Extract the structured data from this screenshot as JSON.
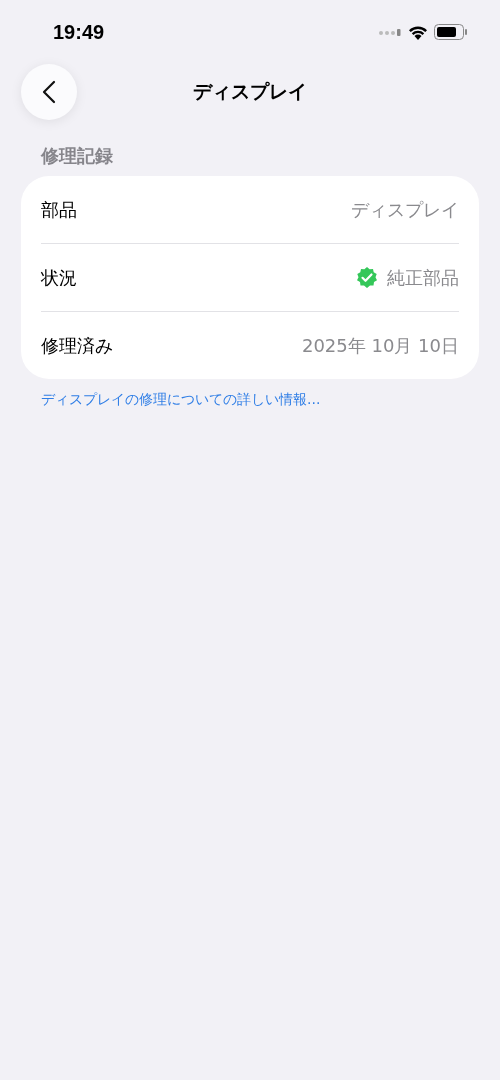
{
  "status_bar": {
    "time": "19:49"
  },
  "nav": {
    "title": "ディスプレイ"
  },
  "section": {
    "header": "修理記録",
    "rows": [
      {
        "kind": "text",
        "label": "部品",
        "value": "ディスプレイ"
      },
      {
        "kind": "verified",
        "label": "状況",
        "value": "純正部品"
      },
      {
        "kind": "text",
        "label": "修理済み",
        "value": "2025年 10月 10日"
      }
    ]
  },
  "link": "ディスプレイの修理についての詳しい情報..."
}
